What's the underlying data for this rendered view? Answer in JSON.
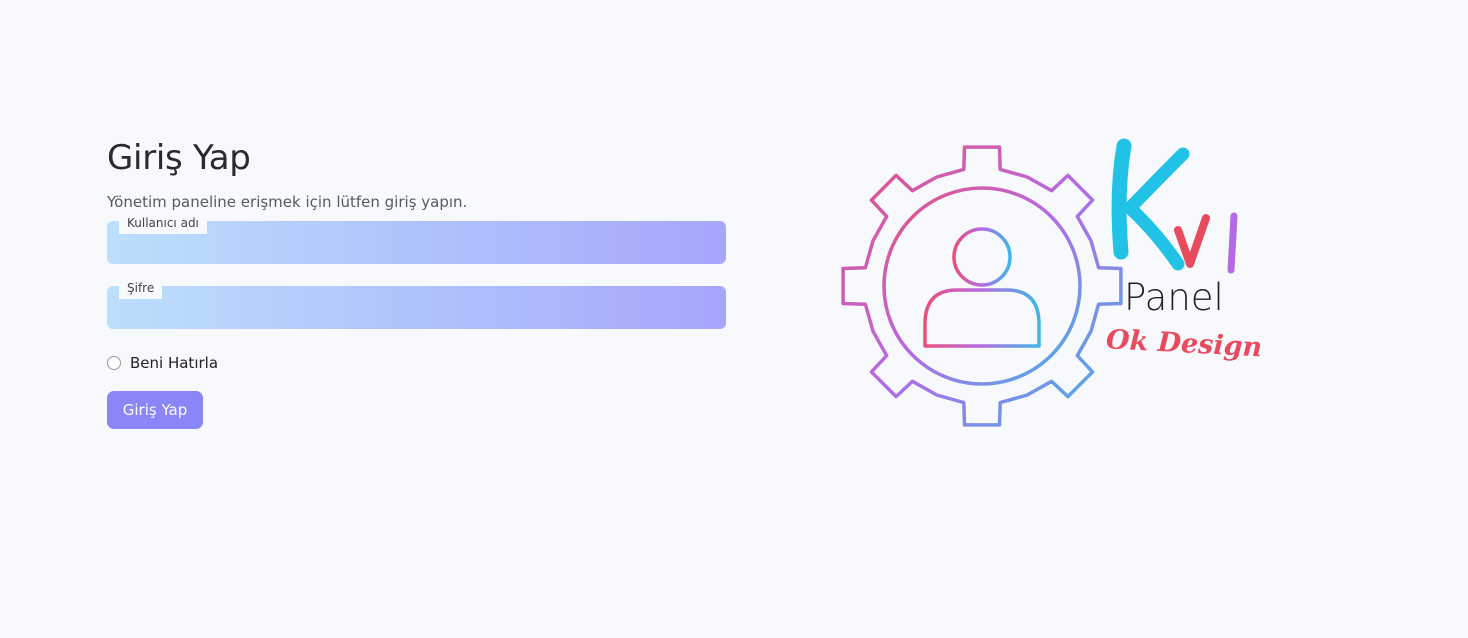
{
  "login": {
    "title": "Giriş Yap",
    "subtitle": "Yönetim paneline erişmek için lütfen giriş yapın.",
    "username_label": "Kullanıcı adı",
    "username_value": "",
    "password_label": "Şifre",
    "password_value": "",
    "remember_label": "Beni Hatırla",
    "submit_label": "Giriş Yap"
  },
  "logo": {
    "text_k": "K",
    "text_v": "V",
    "text_i": "I",
    "text_panel": "Panel",
    "text_tagline": "Ok Design"
  },
  "colors": {
    "background": "#f8f9fd",
    "button": "#8a86f7",
    "field_gradient_start": "#bcdffc",
    "field_gradient_end": "#a6a6fb",
    "logo_pink": "#e8507a",
    "logo_purple": "#b46be6",
    "logo_blue": "#3eb6e6",
    "logo_cyan": "#22c2e6",
    "logo_red": "#e84a5e"
  }
}
